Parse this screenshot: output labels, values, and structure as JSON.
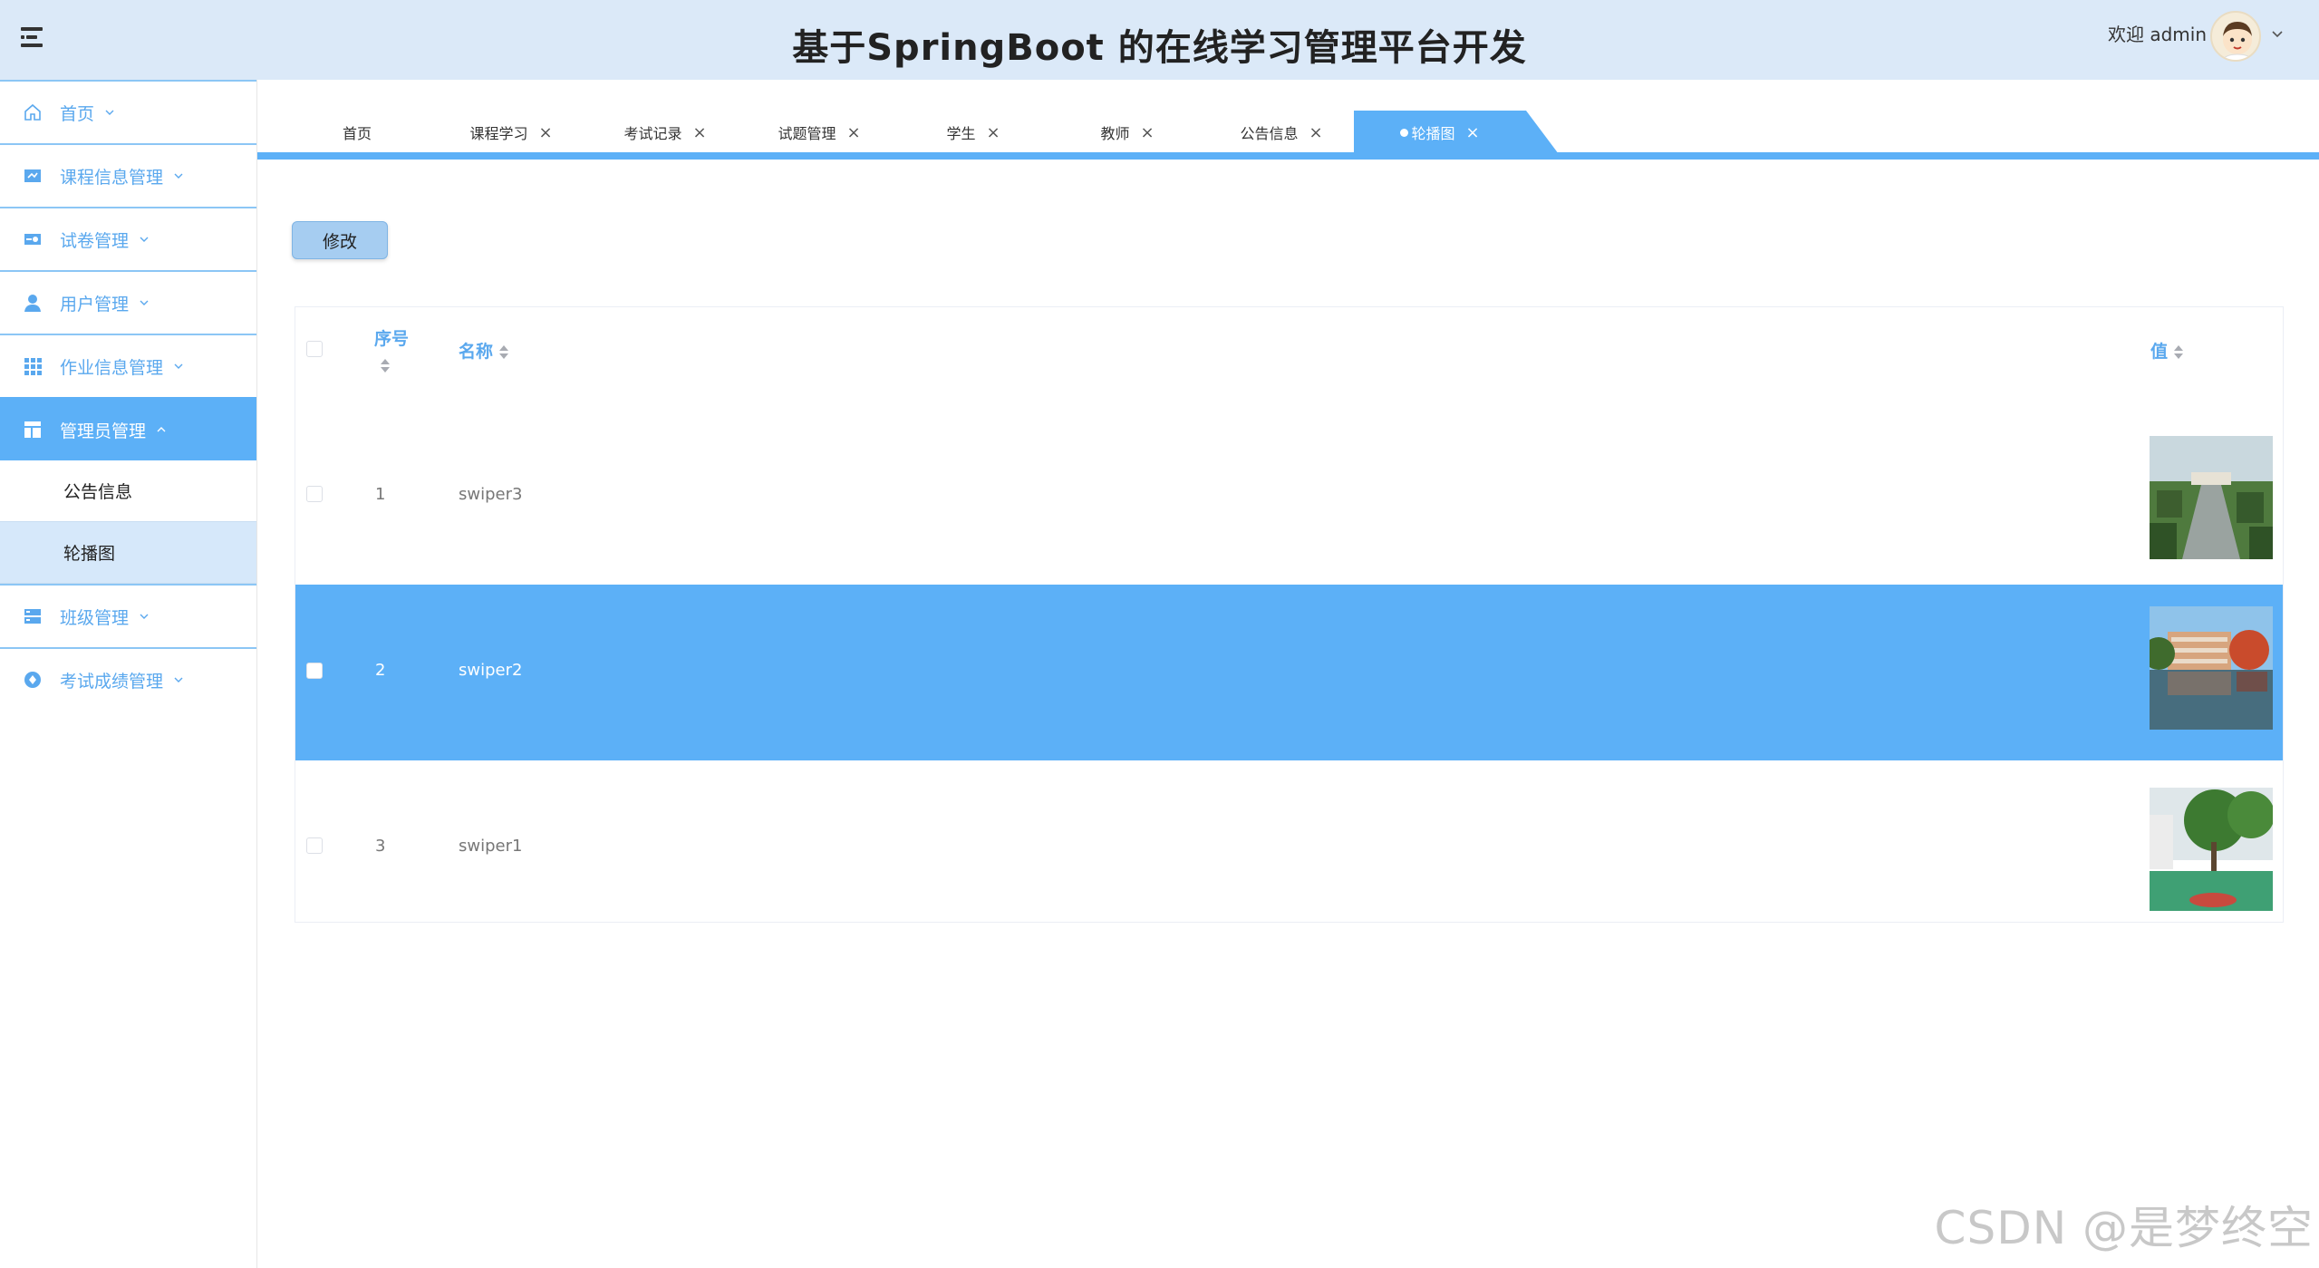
{
  "header": {
    "title": "基于SpringBoot 的在线学习管理平台开发",
    "welcome": "欢迎 admin"
  },
  "sidebar": {
    "items": [
      {
        "label": "首页",
        "icon": "home-icon",
        "expanded": false
      },
      {
        "label": "课程信息管理",
        "icon": "course-icon",
        "expanded": false
      },
      {
        "label": "试卷管理",
        "icon": "exam-paper-icon",
        "expanded": false
      },
      {
        "label": "用户管理",
        "icon": "user-icon",
        "expanded": false
      },
      {
        "label": "作业信息管理",
        "icon": "grid-icon",
        "expanded": false
      },
      {
        "label": "管理员管理",
        "icon": "layout-icon",
        "expanded": true,
        "children": [
          "公告信息",
          "轮播图"
        ]
      },
      {
        "label": "班级管理",
        "icon": "class-icon",
        "expanded": false
      },
      {
        "label": "考试成绩管理",
        "icon": "score-icon",
        "expanded": false
      }
    ],
    "active_child": "轮播图"
  },
  "tabs": [
    {
      "label": "首页",
      "closable": false
    },
    {
      "label": "课程学习",
      "closable": true
    },
    {
      "label": "考试记录",
      "closable": true
    },
    {
      "label": "试题管理",
      "closable": true
    },
    {
      "label": "学生",
      "closable": true
    },
    {
      "label": "教师",
      "closable": true
    },
    {
      "label": "公告信息",
      "closable": true
    },
    {
      "label": "轮播图",
      "closable": true,
      "active": true
    }
  ],
  "toolbar": {
    "edit_label": "修改"
  },
  "table": {
    "columns": [
      "序号",
      "名称",
      "值"
    ],
    "rows": [
      {
        "index": "1",
        "name": "swiper3",
        "image": "campus-road-aerial",
        "selected": false
      },
      {
        "index": "2",
        "name": "swiper2",
        "image": "campus-lake-building",
        "selected": true
      },
      {
        "index": "3",
        "name": "swiper1",
        "image": "campus-court-trees",
        "selected": false
      }
    ]
  },
  "watermark": "CSDN @是梦终空",
  "colors": {
    "header_bg": "#dbe9f8",
    "accent": "#5cb0f7",
    "menu_text": "#5aa8ee"
  }
}
